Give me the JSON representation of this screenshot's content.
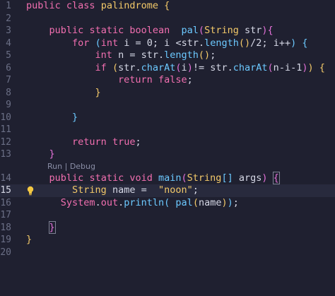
{
  "editor": {
    "line_numbers": [
      "1",
      "2",
      "3",
      "4",
      "5",
      "6",
      "7",
      "8",
      "9",
      "10",
      "11",
      "12",
      "13",
      "14",
      "15",
      "16",
      "17",
      "18",
      "19",
      "20"
    ],
    "active_line": "15",
    "codelens": {
      "run": "Run",
      "separator": "|",
      "debug": "Debug"
    }
  },
  "tokens": {
    "public": "public",
    "class": "class",
    "palindrome": "palindrome",
    "static": "static",
    "boolean": "boolean",
    "pal": "pal",
    "String": "String",
    "str": "str",
    "for": "for",
    "int": "int",
    "i": "i",
    "zero": "0",
    "length": "length",
    "two": "2",
    "n": "n",
    "if": "if",
    "charAt": "charAt",
    "one": "1",
    "return": "return",
    "false": "false",
    "true": "true",
    "void": "void",
    "main": "main",
    "args": "args",
    "name": "name",
    "noon": "\"noon\"",
    "System": "System",
    "out": "out",
    "println": "println"
  },
  "colors": {
    "background": "#1f2030",
    "keyword": "#f26fb0",
    "function": "#6cc9ff",
    "type": "#f3c969",
    "text": "#d6d8e6"
  }
}
